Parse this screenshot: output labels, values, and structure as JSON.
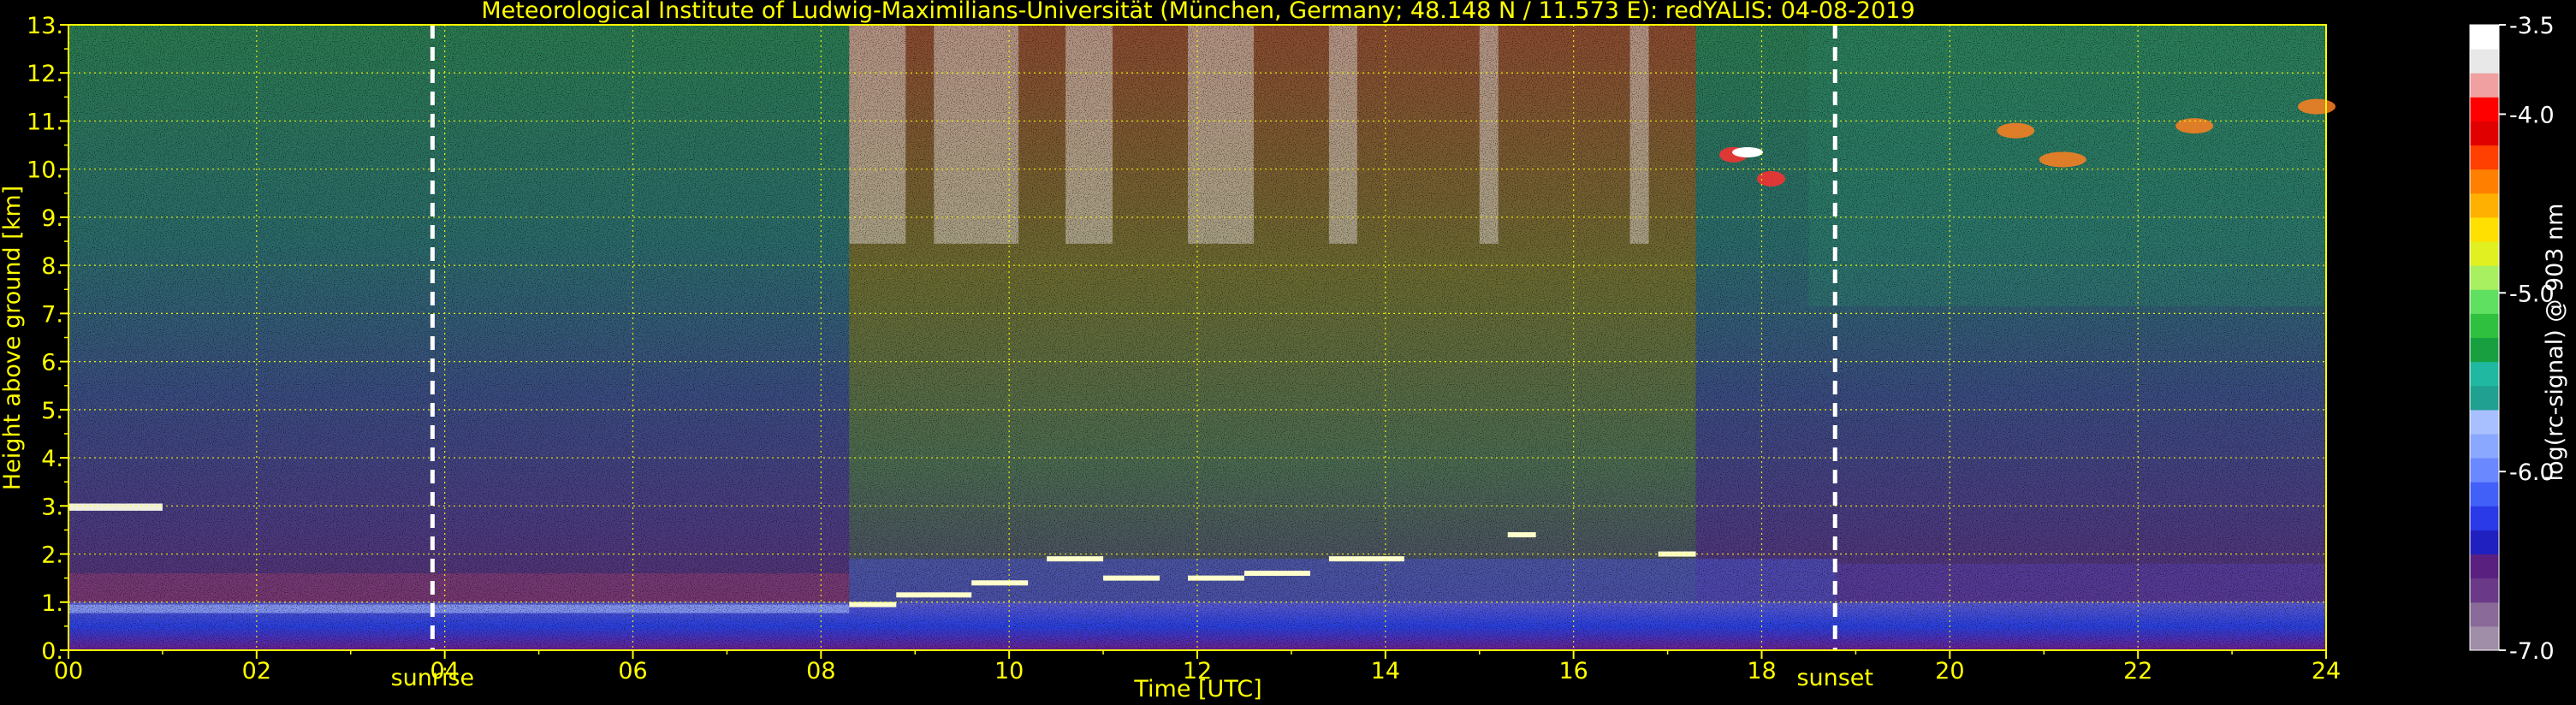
{
  "chart_data": {
    "type": "heatmap",
    "title": "Meteorological Institute of Ludwig-Maximilians-Universität (München, Germany; 48.148 N / 11.573 E):    redYALIS: 04-08-2019",
    "xlabel": "Time [UTC]",
    "ylabel": "Height above ground [km]",
    "xlim": [
      0,
      24
    ],
    "ylim": [
      0,
      13
    ],
    "x_ticks": [
      0,
      2,
      4,
      6,
      8,
      10,
      12,
      14,
      16,
      18,
      20,
      22,
      24
    ],
    "x_tick_labels": [
      "00",
      "02",
      "04",
      "06",
      "08",
      "10",
      "12",
      "14",
      "16",
      "18",
      "20",
      "22",
      "24"
    ],
    "y_ticks": [
      0,
      1,
      2,
      3,
      4,
      5,
      6,
      7,
      8,
      9,
      10,
      11,
      12,
      13
    ],
    "y_tick_labels": [
      "0.",
      "1.",
      "2.",
      "3.",
      "4.",
      "5.",
      "6.",
      "7.",
      "8.",
      "9.",
      "10.",
      "11.",
      "12.",
      "13."
    ],
    "x_minor_ticks": [
      1,
      3,
      5,
      7,
      9,
      11,
      13,
      15,
      17,
      19,
      21,
      23
    ],
    "y_minor_ticks": [
      0.5,
      1.5,
      2.5,
      3.5,
      4.5,
      5.5,
      6.5,
      7.5,
      8.5,
      9.5,
      10.5,
      11.5,
      12.5
    ],
    "grid": true,
    "events": [
      {
        "label": "sunrise",
        "x": 3.87
      },
      {
        "label": "sunset",
        "x": 18.78
      }
    ],
    "colorbar": {
      "label": "log(rc-signal) @ 903 nm",
      "range": [
        -7.0,
        -3.5
      ],
      "tick_values": [
        -3.5,
        -4.0,
        -5.0,
        -6.0,
        -7.0
      ],
      "tick_labels": [
        "-3.5",
        "-4.0",
        "-5.0",
        "-6.0",
        "-7.0"
      ],
      "colors": [
        "#a08ea8",
        "#8a6a98",
        "#6a3a88",
        "#5a2080",
        "#2020c0",
        "#2a3ae8",
        "#4060f8",
        "#6a88ff",
        "#8aa8ff",
        "#a8c0ff",
        "#20a090",
        "#20b8a0",
        "#18a040",
        "#30c040",
        "#60e060",
        "#a8f060",
        "#e0f020",
        "#ffe000",
        "#ffb000",
        "#ff8000",
        "#ff4000",
        "#e00000",
        "#ff0000",
        "#f0a0a0",
        "#e8e8e8",
        "#ffffff"
      ]
    },
    "features": [
      {
        "name": "boundary layer",
        "x_range": [
          0,
          24
        ],
        "height_km": [
          0,
          1.0
        ]
      },
      {
        "name": "residual layer",
        "x_range": [
          0,
          1.0
        ],
        "height_km": [
          2.9,
          3.05
        ]
      },
      {
        "name": "cloud tops",
        "x_range": [
          8.3,
          17.3
        ],
        "height_km": [
          0.9,
          2.5
        ]
      },
      {
        "name": "high clouds",
        "x_range": [
          17.5,
          24
        ],
        "height_km": [
          9.6,
          11.4
        ]
      }
    ]
  }
}
